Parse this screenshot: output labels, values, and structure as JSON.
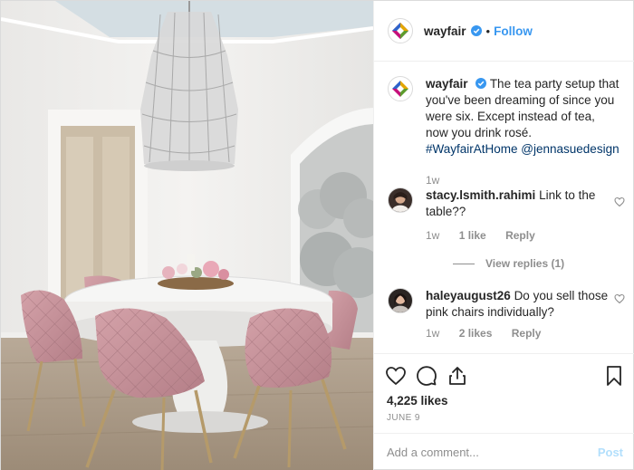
{
  "post": {
    "image_alt": "Round white dining table with pink velvet chairs under a crystal chandelier",
    "colors": {
      "accent": "#3897f0",
      "hashtag": "#003569",
      "muted": "#8e8e8e",
      "chair_pink": "#c9919a",
      "brand_purple": "#7f187f"
    }
  },
  "header": {
    "username": "wayfair",
    "verified_icon": "verified-badge-icon",
    "separator": "•",
    "follow_label": "Follow"
  },
  "caption": {
    "username": "wayfair",
    "text": "The tea party setup that you've been dreaming of since you were six. Except instead of tea, now you drink rosé.",
    "hashtag": "#WayfairAtHome",
    "mention": "@jennasuedesign",
    "time": "1w"
  },
  "comments": [
    {
      "username": "stacy.lsmith.rahimi",
      "text": "Link to the table??",
      "time": "1w",
      "likes": "1 like",
      "reply_label": "Reply",
      "view_replies": "View replies (1)"
    },
    {
      "username": "haleyaugust26",
      "text": "Do you sell those pink chairs individually?",
      "time": "1w",
      "likes": "2 likes",
      "reply_label": "Reply"
    }
  ],
  "actions": {
    "icons": [
      "heart-icon",
      "comment-icon",
      "share-icon",
      "bookmark-icon"
    ],
    "likes_count": "4,225 likes",
    "date": "JUNE 9"
  },
  "add_comment": {
    "placeholder": "Add a comment...",
    "post_label": "Post"
  }
}
